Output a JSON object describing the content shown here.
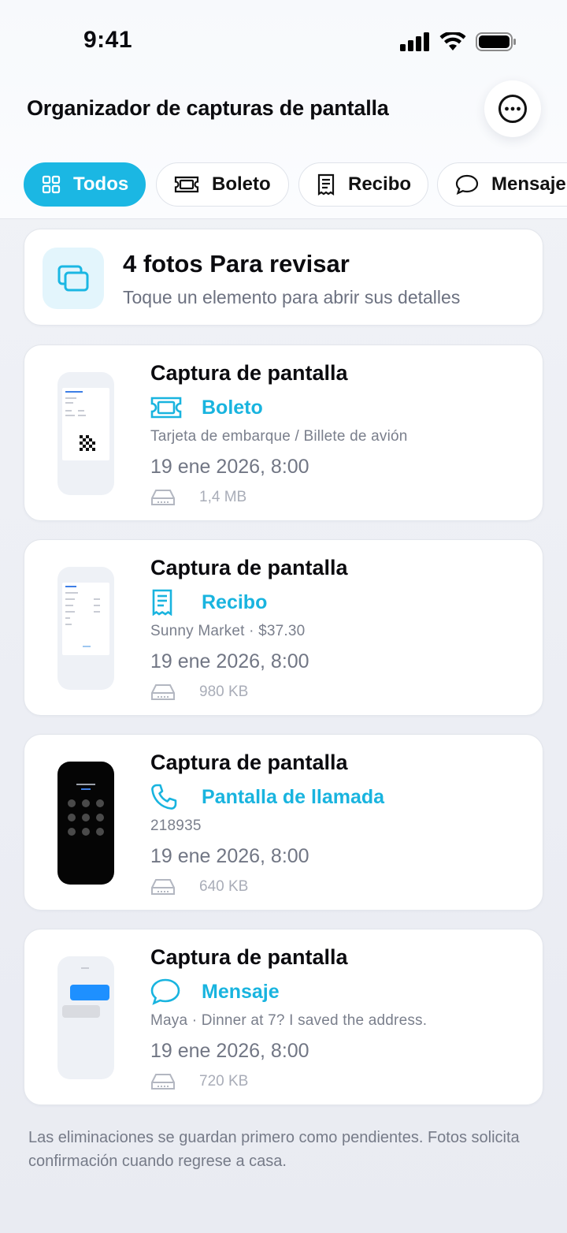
{
  "status_bar": {
    "time": "9:41"
  },
  "header": {
    "title": "Organizador de capturas de pantalla",
    "more_icon": "ellipsis-circle-icon"
  },
  "filters": [
    {
      "label": "Todos",
      "icon": "grid-icon",
      "active": true
    },
    {
      "label": "Boleto",
      "icon": "ticket-icon",
      "active": false
    },
    {
      "label": "Recibo",
      "icon": "receipt-icon",
      "active": false
    },
    {
      "label": "Mensaje",
      "icon": "message-icon",
      "active": false
    }
  ],
  "summary": {
    "title": "4 fotos Para revisar",
    "subtitle": "Toque un elemento para abrir sus detalles",
    "icon": "photos-stack-icon"
  },
  "items": [
    {
      "title": "Captura de pantalla",
      "category": "Boleto",
      "category_icon": "ticket-icon",
      "subtitle": "Tarjeta de embarque / Billete de avión",
      "date": "19 ene 2026, 8:00",
      "size": "1,4 MB"
    },
    {
      "title": "Captura de pantalla",
      "category": "Recibo",
      "category_icon": "receipt-icon",
      "subtitle": "Sunny Market · $37.30",
      "date": "19 ene 2026, 8:00",
      "size": "980 KB"
    },
    {
      "title": "Captura de pantalla",
      "category": "Pantalla de llamada",
      "category_icon": "phone-icon",
      "subtitle": "218935",
      "date": "19 ene 2026, 8:00",
      "size": "640 KB"
    },
    {
      "title": "Captura de pantalla",
      "category": "Mensaje",
      "category_icon": "message-icon",
      "subtitle": "Maya · Dinner at 7? I saved the address.",
      "date": "19 ene 2026, 8:00",
      "size": "720 KB"
    }
  ],
  "footer_note": "Las eliminaciones se guardan primero como pendientes. Fotos solicita confirmación cuando regrese a casa.",
  "colors": {
    "accent": "#1bb7e3",
    "text": "#0b0b0f",
    "muted": "#717684"
  }
}
